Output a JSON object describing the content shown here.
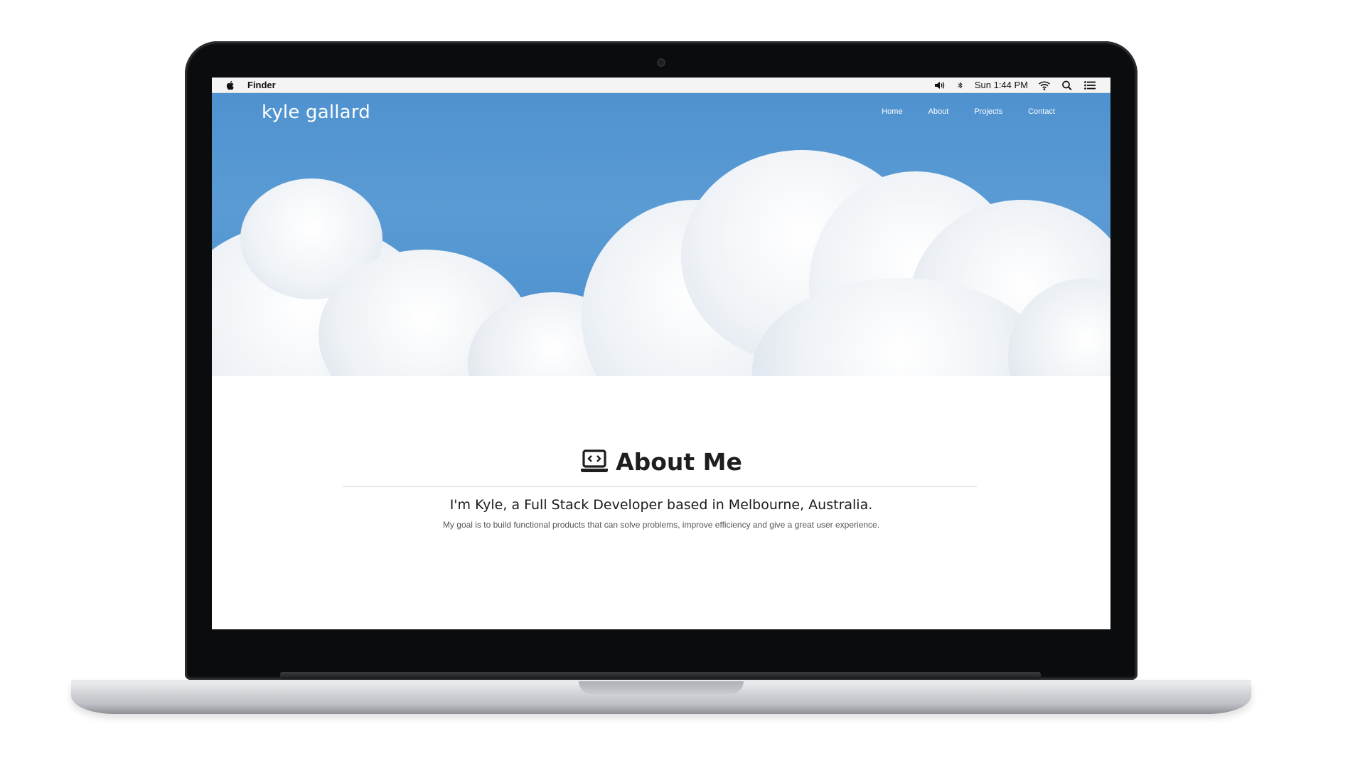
{
  "menubar": {
    "app_name": "Finder",
    "clock": "Sun 1:44 PM",
    "icons": [
      "apple-icon",
      "volume-icon",
      "bluetooth-icon",
      "wifi-icon",
      "spotlight-search-icon",
      "notification-list-icon"
    ]
  },
  "site": {
    "brand": "kyle gallard",
    "nav": {
      "home": "Home",
      "about": "About",
      "projects": "Projects",
      "contact": "Contact"
    }
  },
  "about": {
    "icon": "laptop-code-icon",
    "heading": "About Me",
    "intro": "I'm Kyle, a Full Stack Developer based in Melbourne, Australia.",
    "goal": "My goal is to build functional products that can solve problems, improve efficiency and give a great user experience."
  },
  "colors": {
    "sky": "#4f92cf",
    "heading_text": "#1e1e1e",
    "laptop_frame": "#0b0c0e",
    "laptop_base": "#c8cacd"
  }
}
